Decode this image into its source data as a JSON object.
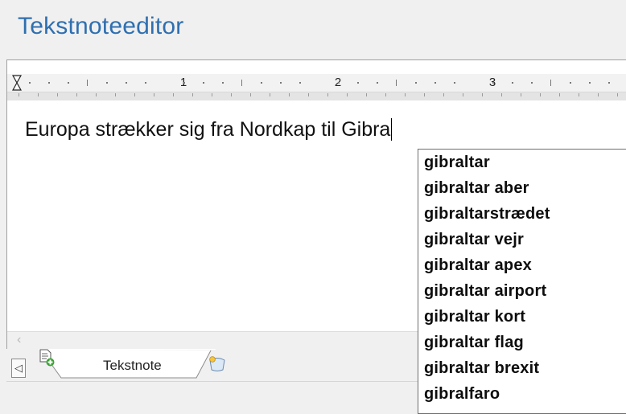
{
  "window": {
    "title": "Tekstnoteeditor"
  },
  "ruler": {
    "numbers": [
      "1",
      "2",
      "3"
    ]
  },
  "editor": {
    "text": "Europa strækker sig fra Nordkap til Gibra"
  },
  "tabs": {
    "active_label": "Tekstnote",
    "nav_left": "◁"
  },
  "suggestions": [
    "gibraltar",
    "gibraltar aber",
    "gibraltarstrædet",
    "gibraltar vejr",
    "gibraltar apex",
    "gibraltar airport",
    "gibraltar kort",
    "gibraltar flag",
    "gibraltar brexit",
    "gibralfaro"
  ],
  "icons": {
    "indent": "hourglass-indent-marker-icon",
    "scroll_left": "chevron-left-icon",
    "tab_doc": "document-add-icon",
    "tab_new": "new-tab-icon"
  },
  "colors": {
    "title": "#2f6fb0",
    "background": "#f0f0f0",
    "editor_bg": "#ffffff"
  }
}
